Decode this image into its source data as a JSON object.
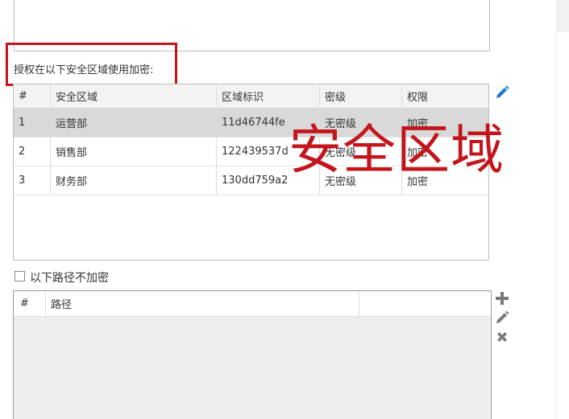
{
  "auth_section": {
    "label": "授权在以下安全区域使用加密:"
  },
  "zone_table": {
    "columns": [
      "#",
      "安全区域",
      "区域标识",
      "密级",
      "权限"
    ],
    "rows": [
      {
        "num": "1",
        "zone": "运营部",
        "id": "11d46744fe",
        "level": "无密级",
        "perm": "加密",
        "selected": true
      },
      {
        "num": "2",
        "zone": "销售部",
        "id": "122439537d",
        "level": "无密级",
        "perm": "加密",
        "selected": false
      },
      {
        "num": "3",
        "zone": "财务部",
        "id": "130dd759a2",
        "level": "无密级",
        "perm": "加密",
        "selected": false
      }
    ]
  },
  "overlay_caption": "安全区域",
  "exclude_section": {
    "checkbox_label": "以下路径不加密",
    "checked": false
  },
  "path_table": {
    "columns": [
      "#",
      "路径",
      ""
    ]
  },
  "icons": {
    "zone_edit": "pencil-icon",
    "path_add": "plus-icon",
    "path_edit": "pencil-icon",
    "path_delete": "x-icon"
  },
  "colors": {
    "highlight": "#c3161c",
    "icon_blue": "#1e78d2",
    "icon_gray": "#7a7a7a",
    "selected_row": "#d9d9d9"
  }
}
